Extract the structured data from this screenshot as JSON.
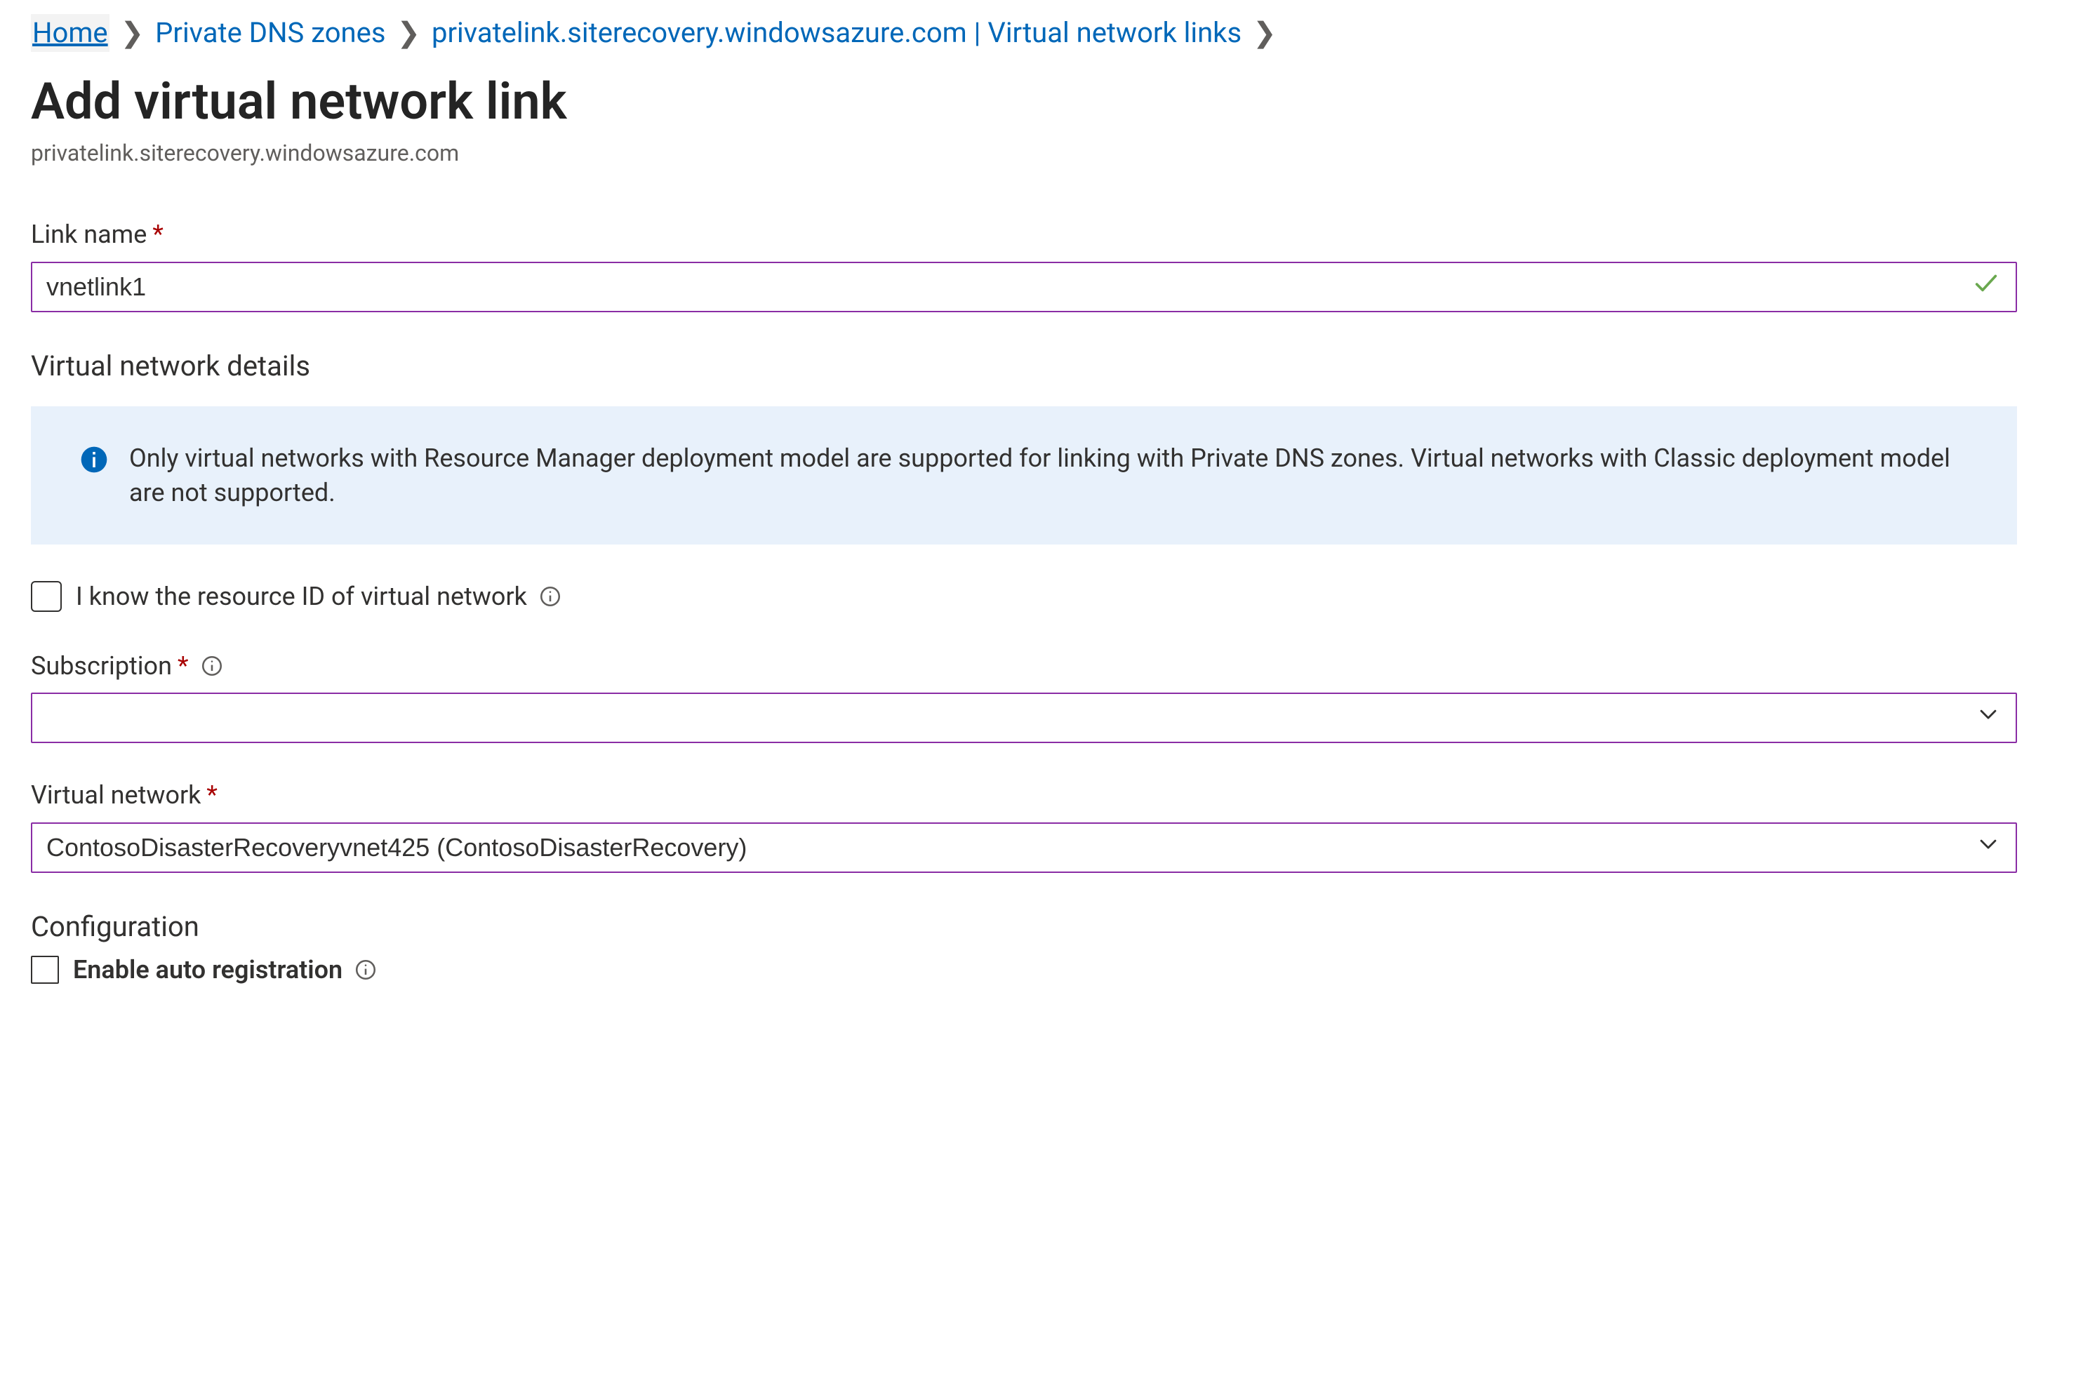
{
  "breadcrumb": {
    "items": [
      "Home",
      "Private DNS zones",
      "privatelink.siterecovery.windowsazure.com | Virtual network links"
    ]
  },
  "title": "Add virtual network link",
  "subtitle": "privatelink.siterecovery.windowsazure.com",
  "fields": {
    "link_name": {
      "label": "Link name",
      "value": "vnetlink1"
    },
    "vnet_details_heading": "Virtual network details",
    "info_banner": "Only virtual networks with Resource Manager deployment model are supported for linking with Private DNS zones. Virtual networks with Classic deployment model are not supported.",
    "know_resource_id": {
      "label": "I know the resource ID of virtual network",
      "checked": false
    },
    "subscription": {
      "label": "Subscription",
      "value": ""
    },
    "virtual_network": {
      "label": "Virtual network",
      "value": "ContosoDisasterRecoveryvnet425 (ContosoDisasterRecovery)"
    },
    "configuration_heading": "Configuration",
    "enable_auto_reg": {
      "label": "Enable auto registration",
      "checked": false
    }
  }
}
